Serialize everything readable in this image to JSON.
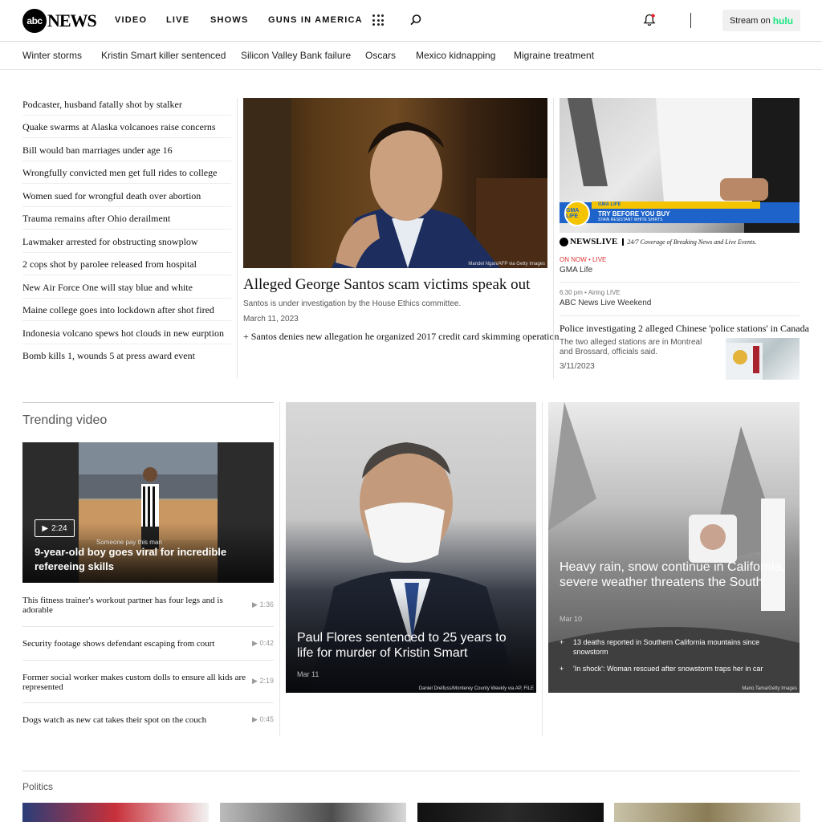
{
  "header": {
    "logo_mark": "abc",
    "logo_word": "NEWS",
    "nav": [
      "VIDEO",
      "LIVE",
      "SHOWS",
      "GUNS IN AMERICA"
    ],
    "stream_label": "Stream on",
    "stream_brand": "hulu",
    "icons": [
      "apps-grid-icon",
      "search-icon",
      "bell-icon"
    ],
    "colors": {
      "hulu_green": "#1ce783",
      "notification_red": "#e0262b"
    }
  },
  "topics": [
    "Winter storms",
    "Kristin Smart killer sentenced",
    "Silicon Valley Bank failure",
    "Oscars",
    "Mexico kidnapping",
    "Migraine treatment"
  ],
  "headlines": [
    "Podcaster, husband fatally shot by stalker",
    "Quake swarms at Alaska volcanoes raise concerns",
    "Bill would ban marriages under age 16",
    "Wrongfully convicted men get full rides to college",
    "Women sued for wrongful death over abortion",
    "Trauma remains after Ohio derailment",
    "Lawmaker arrested for obstructing snowplow",
    "2 cops shot by parolee released from hospital",
    "New Air Force One will stay blue and white",
    "Maine college goes into lockdown after shot fired",
    "Indonesia volcano spews hot clouds in new eurption",
    "Bomb kills 1, wounds 5 at press award event"
  ],
  "lead": {
    "title": "Alleged George Santos scam victims speak out",
    "description": "Santos is under investigation by the House Ethics committee.",
    "date": "March 11, 2023",
    "related": "+ Santos denies new allegation he organized 2017 credit card skimming operation",
    "credit": "Mandel Ngan/AFP via Getty Images"
  },
  "live": {
    "gma_logo": "GMA LIFE",
    "gma_banner_top": "GMA LIFE",
    "gma_banner_title": "TRY BEFORE YOU BUY",
    "gma_banner_sub": "STAIN RESISTANT WHITE SHIRTS",
    "live_brand": "NEWS",
    "live_brand_suffix": "LIVE",
    "tagline": "24/7 Coverage of Breaking News and Live Events.",
    "now_label": "ON NOW",
    "now_live": "LIVE",
    "now_title": "GMA Life",
    "next_time": "6:30 pm",
    "next_status": "Airing LIVE",
    "next_title": "ABC News Live Weekend"
  },
  "side_story": {
    "title": "Police investigating 2 alleged Chinese 'police stations' in Canada",
    "description": "The two alleged stations are in Montreal and Brossard, officials said.",
    "date": "3/11/2023"
  },
  "trending": {
    "title": "Trending video",
    "featured": {
      "duration": "2:24",
      "headline": "9-year-old boy goes viral for incredible refereeing skills",
      "caption": "Someone pay this man"
    },
    "items": [
      {
        "title": "This fitness trainer's workout partner has four legs and is adorable",
        "duration": "1:36"
      },
      {
        "title": "Security footage shows defendant escaping from court",
        "duration": "0:42"
      },
      {
        "title": "Former social worker makes custom dolls to ensure all kids are represented",
        "duration": "2:19"
      },
      {
        "title": "Dogs watch as new cat takes their spot on the couch",
        "duration": "0:45"
      }
    ]
  },
  "flores": {
    "title": "Paul Flores sentenced to 25 years to life for murder of Kristin Smart",
    "date": "Mar 11",
    "credit": "Daniel Dreifuss/Monterey County Weekly via AP, FILE"
  },
  "snow": {
    "title": "Heavy rain, snow continue in California, severe weather threatens the South",
    "date": "Mar 10",
    "related": [
      "13 deaths reported in Southern California mountains since snowstorm",
      "'In shock': Woman rescued after snowstorm traps her in car"
    ],
    "credit": "Mario Tama/Getty Images"
  },
  "politics": {
    "title": "Politics"
  }
}
